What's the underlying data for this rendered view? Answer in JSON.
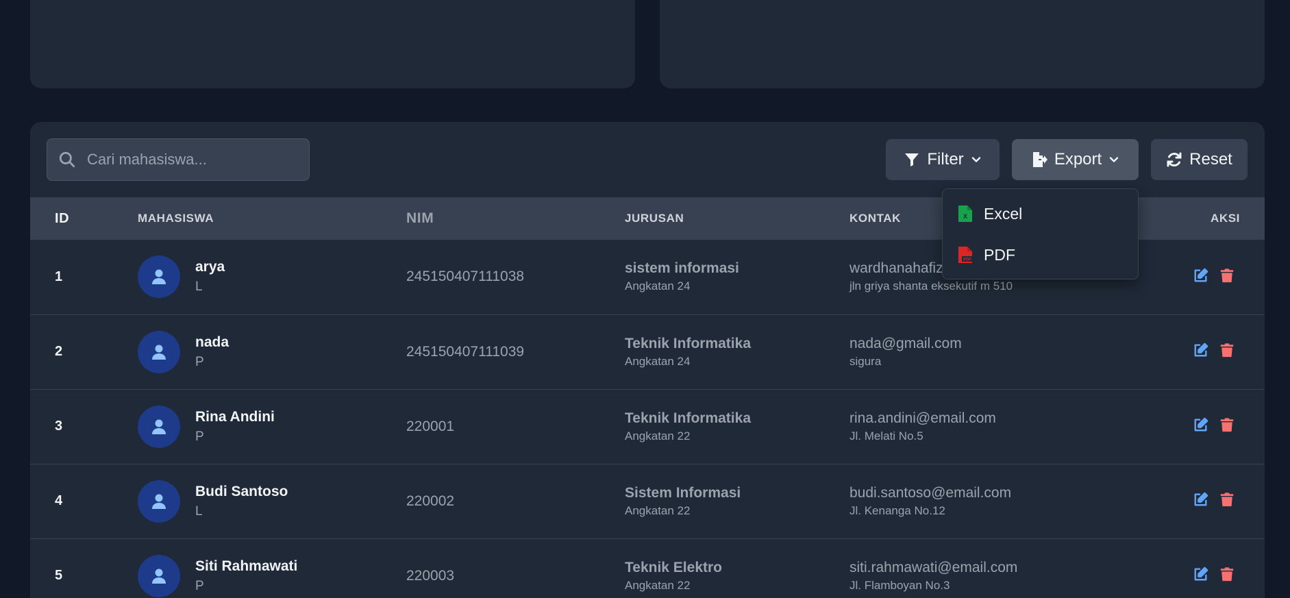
{
  "search": {
    "placeholder": "Cari mahasiswa..."
  },
  "toolbar": {
    "filter_label": "Filter",
    "export_label": "Export",
    "reset_label": "Reset"
  },
  "export_menu": {
    "excel_label": "Excel",
    "pdf_label": "PDF"
  },
  "table": {
    "headers": {
      "id": "ID",
      "mahasiswa": "MAHASISWA",
      "nim": "NIM",
      "jurusan": "JURUSAN",
      "kontak": "KONTAK",
      "aksi": "AKSI"
    },
    "rows": [
      {
        "id": "1",
        "name": "arya",
        "gender": "L",
        "nim": "245150407111038",
        "jurusan": "sistem informasi",
        "angkatan": "Angkatan 24",
        "email": "wardhanahafiz",
        "alamat": "jln griya shanta eksekutif m 510"
      },
      {
        "id": "2",
        "name": "nada",
        "gender": "P",
        "nim": "245150407111039",
        "jurusan": "Teknik Informatika",
        "angkatan": "Angkatan 24",
        "email": "nada@gmail.com",
        "alamat": "sigura"
      },
      {
        "id": "3",
        "name": "Rina Andini",
        "gender": "P",
        "nim": "220001",
        "jurusan": "Teknik Informatika",
        "angkatan": "Angkatan 22",
        "email": "rina.andini@email.com",
        "alamat": "Jl. Melati No.5"
      },
      {
        "id": "4",
        "name": "Budi Santoso",
        "gender": "L",
        "nim": "220002",
        "jurusan": "Sistem Informasi",
        "angkatan": "Angkatan 22",
        "email": "budi.santoso@email.com",
        "alamat": "Jl. Kenanga No.12"
      },
      {
        "id": "5",
        "name": "Siti Rahmawati",
        "gender": "P",
        "nim": "220003",
        "jurusan": "Teknik Elektro",
        "angkatan": "Angkatan 22",
        "email": "siti.rahmawati@email.com",
        "alamat": "Jl. Flamboyan No.3"
      }
    ]
  },
  "icons": {
    "search": "search-icon",
    "filter": "filter-icon",
    "export": "file-export-icon",
    "reset": "sync-icon",
    "excel": "file-excel-icon",
    "pdf": "file-pdf-icon",
    "avatar": "user-icon",
    "edit": "edit-icon",
    "delete": "trash-icon"
  },
  "colors": {
    "background": "#111827",
    "card": "#1f2937",
    "header_row": "#374151",
    "avatar_bg": "#1e3a8a",
    "avatar_icon": "#93c5fd",
    "edit": "#60a5fa",
    "delete": "#f87171",
    "excel": "#16a34a",
    "pdf": "#dc2626"
  }
}
